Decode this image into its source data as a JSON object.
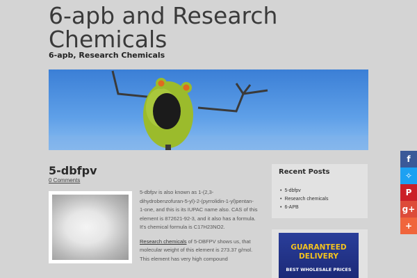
{
  "site": {
    "title": "6-apb and Research Chemicals",
    "description": "6-apb, Research Chemicals"
  },
  "post": {
    "title": "5-dbfpv",
    "comments": "0 Comments",
    "paragraph1": "5-dbfpv is also known as 1-(2,3-dihydrobenzofuran-5-yl)-2-(pyrrolidin-1-yl)pentan-1-one, and this is its IUPAC name also. CAS of this element is 872621-92-3, and it also has a formula. It's chemical formula is C17H23NO2.",
    "paragraph2_link": "Research chemicals",
    "paragraph2_rest": " of 5-DBFPV shows us, that molecular weight of this element is 273.37 g/mol. This element has very high compound"
  },
  "sidebar": {
    "recent_title": "Recent Posts",
    "recent_items": [
      "5-dbfpv",
      "Research chemicals",
      "6-APB"
    ],
    "ad": {
      "headline": "GUARANTEED DELIVERY",
      "subline": "BEST WHOLESALE PRICES"
    }
  },
  "share": [
    {
      "icon": "facebook-icon",
      "glyph": "f",
      "color": "#3b5998"
    },
    {
      "icon": "twitter-icon",
      "glyph": "✧",
      "color": "#1da1f2"
    },
    {
      "icon": "pinterest-icon",
      "glyph": "P",
      "color": "#cb2027"
    },
    {
      "icon": "googleplus-icon",
      "glyph": "g+",
      "color": "#dd4b39"
    },
    {
      "icon": "more-icon",
      "glyph": "+",
      "color": "#f0653c"
    }
  ]
}
